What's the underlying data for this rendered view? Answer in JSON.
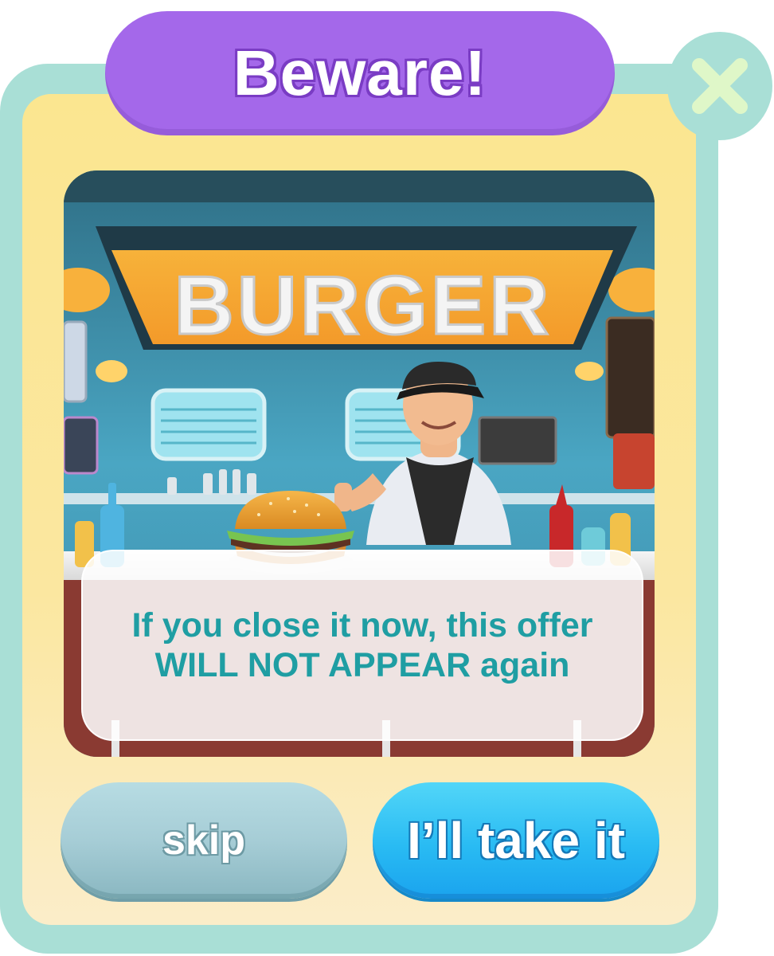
{
  "popup": {
    "title": "Beware!",
    "close_icon": "close-x-icon",
    "colors": {
      "frame": "#a9dfd6",
      "panel": "#fbe690",
      "title_pill": "#a468ea",
      "message_text": "#1f9ea3",
      "primary_button": "#29bbf3",
      "secondary_button": "#a6cdd6"
    }
  },
  "scene": {
    "sign_text": "BURGER",
    "description_icon": "burger-diner-illustration"
  },
  "message": {
    "line1": "If you close it now, this offer",
    "line2": "WILL NOT APPEAR again"
  },
  "buttons": {
    "skip_label": "skip",
    "accept_label": "I’ll take it"
  }
}
